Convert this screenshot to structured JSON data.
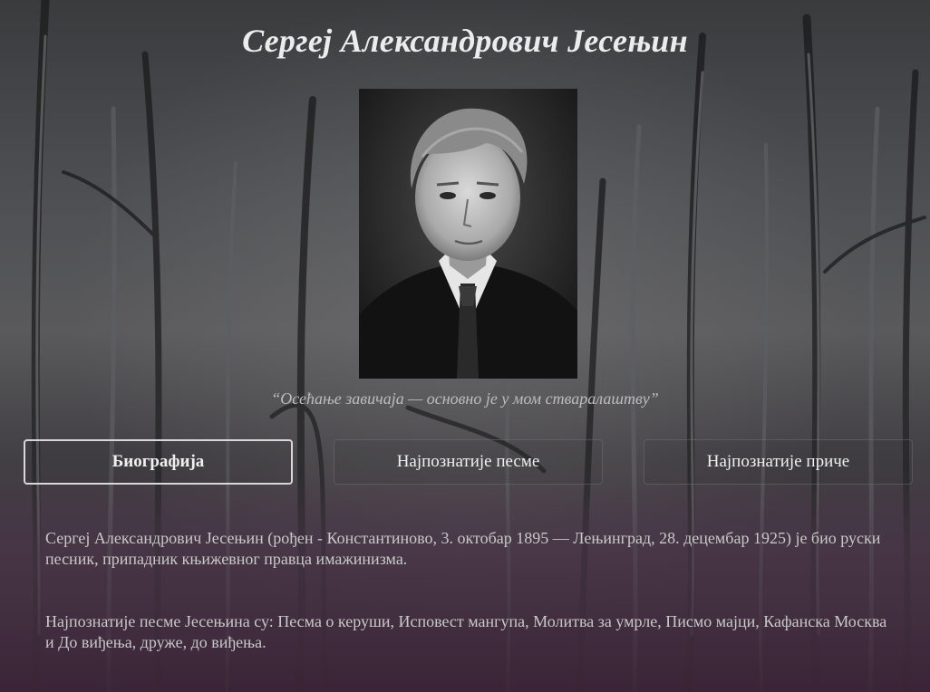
{
  "page": {
    "title": "Сергеј Александрович Јесењин",
    "quote": "“Осећање завичаја — основно је у мом стваралаштву”"
  },
  "tabs": [
    {
      "label": "Биографија",
      "active": true
    },
    {
      "label": "Најпознатије песме",
      "active": false
    },
    {
      "label": "Најпознатије приче",
      "active": false
    }
  ],
  "content": {
    "paragraphs": [
      "Сергеј Александрович Јесењин (рођен - Константиново, 3. октобар 1895 — Лењинград, 28. децембар 1925) је био руски песник, припадник књижевног правца имажинизма.",
      "Најпознатије песме Јесењина су: Песма о керуши, Исповест мангупа, Молитва за умрле, Писмо мајци, Кафанска Москва и До виђења, друже, до виђења."
    ]
  },
  "colors": {
    "title": "#ececec",
    "text": "#c9c9c9",
    "active_border": "#d8d8d8"
  }
}
